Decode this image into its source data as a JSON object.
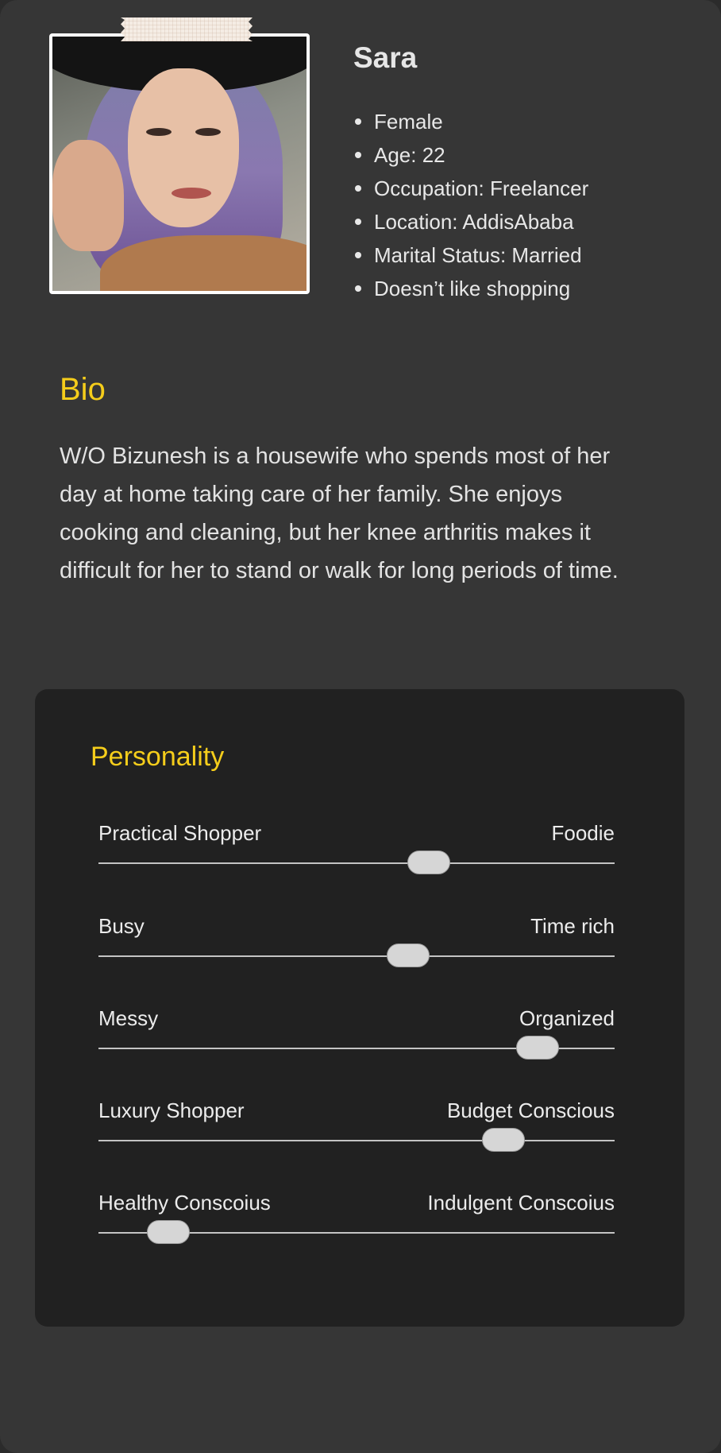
{
  "profile": {
    "name": "Sara",
    "facts": [
      "Female",
      "Age: 22",
      "Occupation: Freelancer",
      "Location: AddisAbaba",
      "Marital Status: Married",
      "Doesn’t like shopping"
    ]
  },
  "bio": {
    "title": "Bio",
    "text": "W/O Bizunesh is a housewife who spends most of her day at home taking care of her family. She enjoys cooking and cleaning, but her knee arthritis makes it difficult for her to stand or walk for long periods of time."
  },
  "personality": {
    "title": "Personality",
    "sliders": [
      {
        "left": "Practical Shopper",
        "right": "Foodie",
        "value": 0.64
      },
      {
        "left": "Busy",
        "right": "Time rich",
        "value": 0.6
      },
      {
        "left": "Messy",
        "right": "Organized",
        "value": 0.85
      },
      {
        "left": "Luxury Shopper",
        "right": "Budget Conscious",
        "value": 0.785
      },
      {
        "left": "Healthy Conscoius",
        "right": "Indulgent Conscoius",
        "value": 0.135
      }
    ]
  },
  "colors": {
    "accent": "#f5cd1b",
    "card": "#363636",
    "panel": "#212121"
  }
}
